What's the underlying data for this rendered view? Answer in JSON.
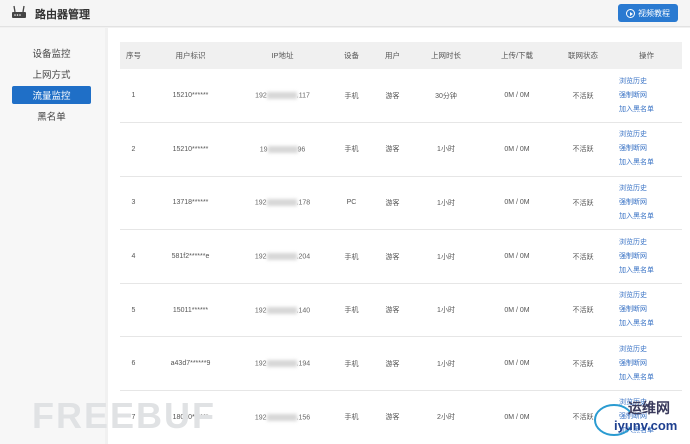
{
  "app": {
    "title": "路由器管理",
    "video_button": "视频教程"
  },
  "sidebar": {
    "items": [
      {
        "label": "设备监控",
        "active": false
      },
      {
        "label": "上网方式",
        "active": false
      },
      {
        "label": "流量监控",
        "active": true
      },
      {
        "label": "黑名单",
        "active": false
      }
    ]
  },
  "table": {
    "headers": [
      "序号",
      "用户标识",
      "IP地址",
      "设备",
      "用户",
      "上网时长",
      "上传/下载",
      "联网状态",
      "操作"
    ],
    "rows": [
      {
        "no": "1",
        "user_id": "15210******",
        "ip_prefix": "192",
        "ip_suffix": ".117",
        "device": "手机",
        "user": "游客",
        "duration": "30分钟",
        "traffic": "0M / 0M",
        "status": "不活跃"
      },
      {
        "no": "2",
        "user_id": "15210******",
        "ip_prefix": "19",
        "ip_suffix": "96",
        "device": "手机",
        "user": "游客",
        "duration": "1小时",
        "traffic": "0M / 0M",
        "status": "不活跃"
      },
      {
        "no": "3",
        "user_id": "13718******",
        "ip_prefix": "192",
        "ip_suffix": ".178",
        "device": "PC",
        "user": "游客",
        "duration": "1小时",
        "traffic": "0M / 0M",
        "status": "不活跃"
      },
      {
        "no": "4",
        "user_id": "581f2******e",
        "ip_prefix": "192",
        "ip_suffix": ".204",
        "device": "手机",
        "user": "游客",
        "duration": "1小时",
        "traffic": "0M / 0M",
        "status": "不活跃"
      },
      {
        "no": "5",
        "user_id": "15011******",
        "ip_prefix": "192",
        "ip_suffix": ".140",
        "device": "手机",
        "user": "游客",
        "duration": "1小时",
        "traffic": "0M / 0M",
        "status": "不活跃"
      },
      {
        "no": "6",
        "user_id": "a43d7******9",
        "ip_prefix": "192",
        "ip_suffix": ".194",
        "device": "手机",
        "user": "游客",
        "duration": "1小时",
        "traffic": "0M / 0M",
        "status": "不活跃"
      },
      {
        "no": "7",
        "user_id": "18010******",
        "ip_prefix": "192",
        "ip_suffix": ".156",
        "device": "手机",
        "user": "游客",
        "duration": "2小时",
        "traffic": "0M / 0M",
        "status": "不活跃"
      }
    ],
    "actions": [
      "浏览历史",
      "强制断网",
      "加入黑名单"
    ]
  },
  "watermarks": {
    "left": "FREEBUF",
    "right_cn": "运维网",
    "right_en": "iyunv.com"
  },
  "colors": {
    "accent": "#1f6fc7",
    "link": "#3a73c5"
  }
}
